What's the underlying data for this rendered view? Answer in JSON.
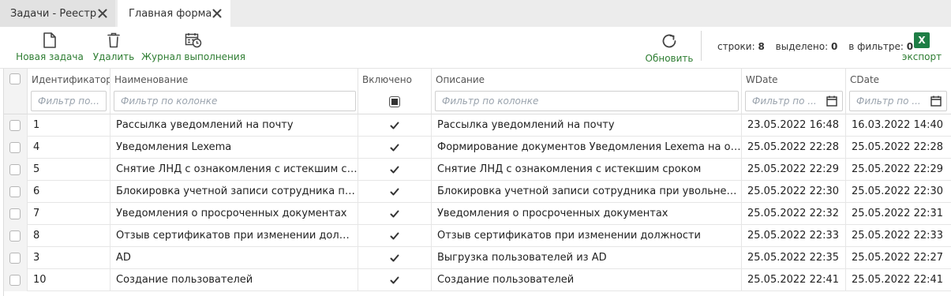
{
  "tabs": [
    {
      "label": "Задачи - Реестр"
    },
    {
      "label": "Главная форма"
    }
  ],
  "toolbar": {
    "new_task": "Новая задача",
    "delete": "Удалить",
    "journal": "Журнал выполнения",
    "refresh": "Обновить",
    "export": "экспорт",
    "export_icon_text": "X"
  },
  "stats": {
    "rows_label": "строки:",
    "rows_value": "8",
    "selected_label": "выделено:",
    "selected_value": "0",
    "filtered_label": "в фильтре:",
    "filtered_value": "0"
  },
  "columns": {
    "id": "Идентификатор",
    "name": "Наименование",
    "enabled": "Включено",
    "description": "Описание",
    "wdate": "WDate",
    "cdate": "CDate"
  },
  "filters": {
    "id_placeholder": "Фильтр по...",
    "name_placeholder": "Фильтр по колонке",
    "description_placeholder": "Фильтр по колонке",
    "wdate_placeholder": "Фильтр по ...",
    "cdate_placeholder": "Фильтр по ..."
  },
  "rows": [
    {
      "id": "1",
      "name": "Рассылка уведомлений на почту",
      "enabled": true,
      "description": "Рассылка уведомлений на почту",
      "wdate": "23.05.2022 16:48",
      "cdate": "16.03.2022 14:40"
    },
    {
      "id": "4",
      "name": "Уведомления Lexema",
      "enabled": true,
      "description": "Формирование документов Уведомления Lexema на осн...",
      "wdate": "25.05.2022 22:28",
      "cdate": "25.05.2022 22:28"
    },
    {
      "id": "5",
      "name": "Снятие ЛНД с ознакомления с истекшим срок...",
      "enabled": true,
      "description": "Снятие ЛНД с ознакомления с истекшим сроком",
      "wdate": "25.05.2022 22:29",
      "cdate": "25.05.2022 22:29"
    },
    {
      "id": "6",
      "name": "Блокировка учетной записи сотрудника при ...",
      "enabled": true,
      "description": "Блокировка учетной записи сотрудника при увольнении",
      "wdate": "25.05.2022 22:30",
      "cdate": "25.05.2022 22:30"
    },
    {
      "id": "7",
      "name": "Уведомления о просроченных документах",
      "enabled": true,
      "description": "Уведомления о просроченных документах",
      "wdate": "25.05.2022 22:32",
      "cdate": "25.05.2022 22:31"
    },
    {
      "id": "8",
      "name": "Отзыв сертификатов при изменении должно...",
      "enabled": true,
      "description": "Отзыв сертификатов при изменении должности",
      "wdate": "25.05.2022 22:33",
      "cdate": "25.05.2022 22:33"
    },
    {
      "id": "3",
      "name": "AD",
      "enabled": true,
      "description": "Выгрузка пользователей из AD",
      "wdate": "25.05.2022 22:35",
      "cdate": "25.05.2022 22:27"
    },
    {
      "id": "10",
      "name": "Создание пользователей",
      "enabled": true,
      "description": "Создание пользователей",
      "wdate": "25.05.2022 22:41",
      "cdate": "25.05.2022 22:41"
    }
  ],
  "colors": {
    "accent_green": "#2e7d32",
    "excel_green": "#1e7e45",
    "tab_bar": "#ececec"
  }
}
